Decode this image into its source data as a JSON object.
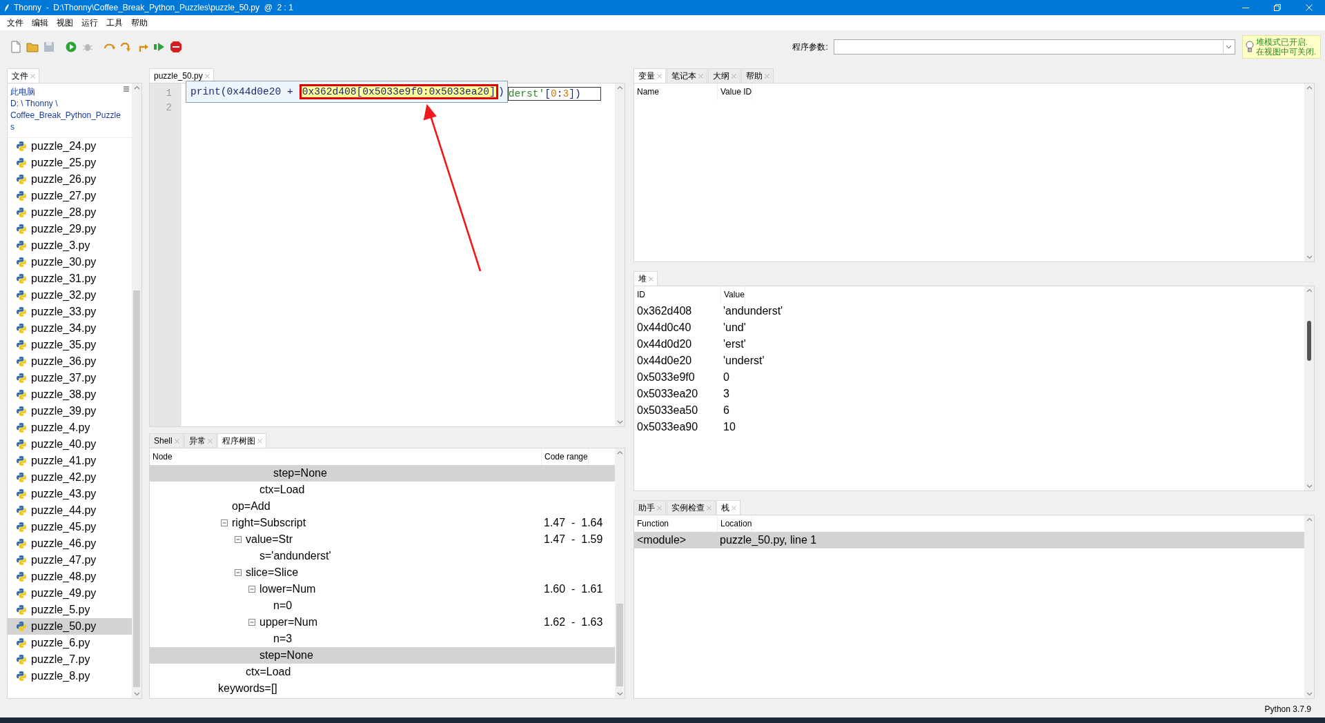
{
  "window": {
    "title": "Thonny  -  D:\\Thonny\\Coffee_Break_Python_Puzzles\\puzzle_50.py  @  2 : 1"
  },
  "menu": [
    "文件",
    "编辑",
    "视图",
    "运行",
    "工具",
    "帮助"
  ],
  "toolbar": {
    "buttons": [
      {
        "kind": "new",
        "disabled": false
      },
      {
        "kind": "open",
        "disabled": false
      },
      {
        "kind": "save",
        "disabled": true
      },
      {
        "kind": "run",
        "disabled": false
      },
      {
        "kind": "debug",
        "disabled": true
      },
      {
        "kind": "step_over",
        "disabled": false
      },
      {
        "kind": "step_into",
        "disabled": false
      },
      {
        "kind": "step_out",
        "disabled": false
      },
      {
        "kind": "resume",
        "disabled": false
      },
      {
        "kind": "stop",
        "disabled": false
      }
    ],
    "args_label": "程序参数:",
    "notice": [
      "堆模式已开启.",
      "在视图中可关闭."
    ]
  },
  "files": {
    "tabs": [
      {
        "label": "文件",
        "selected": true
      }
    ],
    "path": [
      "此电脑",
      "D: \\ Thonny \\",
      "Coffee_Break_Python_Puzzle",
      "s"
    ],
    "items": [
      {
        "name": "puzzle_24.py",
        "selected": false
      },
      {
        "name": "puzzle_25.py",
        "selected": false
      },
      {
        "name": "puzzle_26.py",
        "selected": false
      },
      {
        "name": "puzzle_27.py",
        "selected": false
      },
      {
        "name": "puzzle_28.py",
        "selected": false
      },
      {
        "name": "puzzle_29.py",
        "selected": false
      },
      {
        "name": "puzzle_3.py",
        "selected": false
      },
      {
        "name": "puzzle_30.py",
        "selected": false
      },
      {
        "name": "puzzle_31.py",
        "selected": false
      },
      {
        "name": "puzzle_32.py",
        "selected": false
      },
      {
        "name": "puzzle_33.py",
        "selected": false
      },
      {
        "name": "puzzle_34.py",
        "selected": false
      },
      {
        "name": "puzzle_35.py",
        "selected": false
      },
      {
        "name": "puzzle_36.py",
        "selected": false
      },
      {
        "name": "puzzle_37.py",
        "selected": false
      },
      {
        "name": "puzzle_38.py",
        "selected": false
      },
      {
        "name": "puzzle_39.py",
        "selected": false
      },
      {
        "name": "puzzle_4.py",
        "selected": false
      },
      {
        "name": "puzzle_40.py",
        "selected": false
      },
      {
        "name": "puzzle_41.py",
        "selected": false
      },
      {
        "name": "puzzle_42.py",
        "selected": false
      },
      {
        "name": "puzzle_43.py",
        "selected": false
      },
      {
        "name": "puzzle_44.py",
        "selected": false
      },
      {
        "name": "puzzle_45.py",
        "selected": false
      },
      {
        "name": "puzzle_46.py",
        "selected": false
      },
      {
        "name": "puzzle_47.py",
        "selected": false
      },
      {
        "name": "puzzle_48.py",
        "selected": false
      },
      {
        "name": "puzzle_49.py",
        "selected": false
      },
      {
        "name": "puzzle_5.py",
        "selected": false
      },
      {
        "name": "puzzle_50.py",
        "selected": true
      },
      {
        "name": "puzzle_6.py",
        "selected": false
      },
      {
        "name": "puzzle_7.py",
        "selected": false
      },
      {
        "name": "puzzle_8.py",
        "selected": false
      }
    ]
  },
  "editor": {
    "tabs": [
      {
        "label": "puzzle_50.py",
        "selected": true
      }
    ],
    "line_numbers": [
      "1",
      "2"
    ],
    "evaluation_popup": [
      {
        "kind": "plain",
        "text": "print(0x44d0e20 + "
      },
      {
        "kind": "highlight",
        "text": "0x362d408[0x5033e9f0:0x5033ea20]"
      },
      {
        "kind": "plain",
        "text": ")"
      }
    ],
    "code_behind": [
      {
        "kind": "string",
        "text": "derst'"
      },
      {
        "kind": "plain",
        "text": "["
      },
      {
        "kind": "number",
        "text": "0"
      },
      {
        "kind": "plain",
        "text": ":"
      },
      {
        "kind": "number",
        "text": "3"
      },
      {
        "kind": "plain",
        "text": "])"
      }
    ]
  },
  "ast": {
    "tabs": [
      {
        "label": "Shell",
        "selected": false
      },
      {
        "label": "异常",
        "selected": false
      },
      {
        "label": "程序树图",
        "selected": true
      }
    ],
    "columns": [
      "Node",
      "Code range"
    ],
    "nodes": [
      {
        "children": [
          {
            "children": [
              {
                "children": [
                  {
                    "children": [
                      {
                        "label": "step=None",
                        "selected": true
                      }
                    ]
                  },
                  {
                    "label": "ctx=Load",
                    "selected": false
                  }
                ]
              }
            ]
          },
          {
            "label": "op=Add",
            "selected": false
          },
          {
            "label": "right=Subscript",
            "range": "1.47  -  1.64",
            "selected": false,
            "expanded": true,
            "children": [
              {
                "label": "value=Str",
                "range": "1.47  -  1.59",
                "selected": false,
                "expanded": true,
                "children": [
                  {
                    "label": "s='andunderst'",
                    "selected": false
                  }
                ]
              },
              {
                "label": "slice=Slice",
                "selected": false,
                "expanded": true,
                "children": [
                  {
                    "label": "lower=Num",
                    "range": "1.60  -  1.61",
                    "selected": false,
                    "expanded": true,
                    "children": [
                      {
                        "label": "n=0",
                        "selected": false
                      }
                    ]
                  },
                  {
                    "label": "upper=Num",
                    "range": "1.62  -  1.63",
                    "selected": false,
                    "expanded": true,
                    "children": [
                      {
                        "label": "n=3",
                        "selected": false
                      }
                    ]
                  },
                  {
                    "label": "step=None",
                    "selected": true
                  }
                ]
              },
              {
                "label": "ctx=Load",
                "selected": false
              }
            ]
          }
        ]
      },
      {
        "label": "keywords=[]",
        "selected": false
      }
    ]
  },
  "variables": {
    "tabs": [
      {
        "label": "变量",
        "selected": true
      },
      {
        "label": "笔记本",
        "selected": false
      },
      {
        "label": "大纲",
        "selected": false
      },
      {
        "label": "帮助",
        "selected": false
      }
    ],
    "columns": [
      "Name",
      "Value ID"
    ]
  },
  "heap": {
    "tabs": [
      {
        "label": "堆",
        "selected": true
      }
    ],
    "columns": [
      "ID",
      "Value"
    ],
    "rows": [
      {
        "id": "0x362d408",
        "value": "'andunderst'",
        "selected": false
      },
      {
        "id": "0x44d0c40",
        "value": "'und'",
        "selected": false
      },
      {
        "id": "0x44d0d20",
        "value": "'erst'",
        "selected": false
      },
      {
        "id": "0x44d0e20",
        "value": "'underst'",
        "selected": false
      },
      {
        "id": "0x5033e9f0",
        "value": "0",
        "selected": false
      },
      {
        "id": "0x5033ea20",
        "value": "3",
        "selected": false
      },
      {
        "id": "0x5033ea50",
        "value": "6",
        "selected": false
      },
      {
        "id": "0x5033ea90",
        "value": "10",
        "selected": false
      }
    ]
  },
  "stack": {
    "tabs": [
      {
        "label": "助手",
        "selected": false
      },
      {
        "label": "实例检查",
        "selected": false
      },
      {
        "label": "栈",
        "selected": true
      }
    ],
    "columns": [
      "Function",
      "Location"
    ],
    "rows": [
      {
        "function": "<module>",
        "location": "puzzle_50.py, line 1",
        "selected": true
      }
    ]
  },
  "status_bar": {
    "text": "Python 3.7.9"
  }
}
